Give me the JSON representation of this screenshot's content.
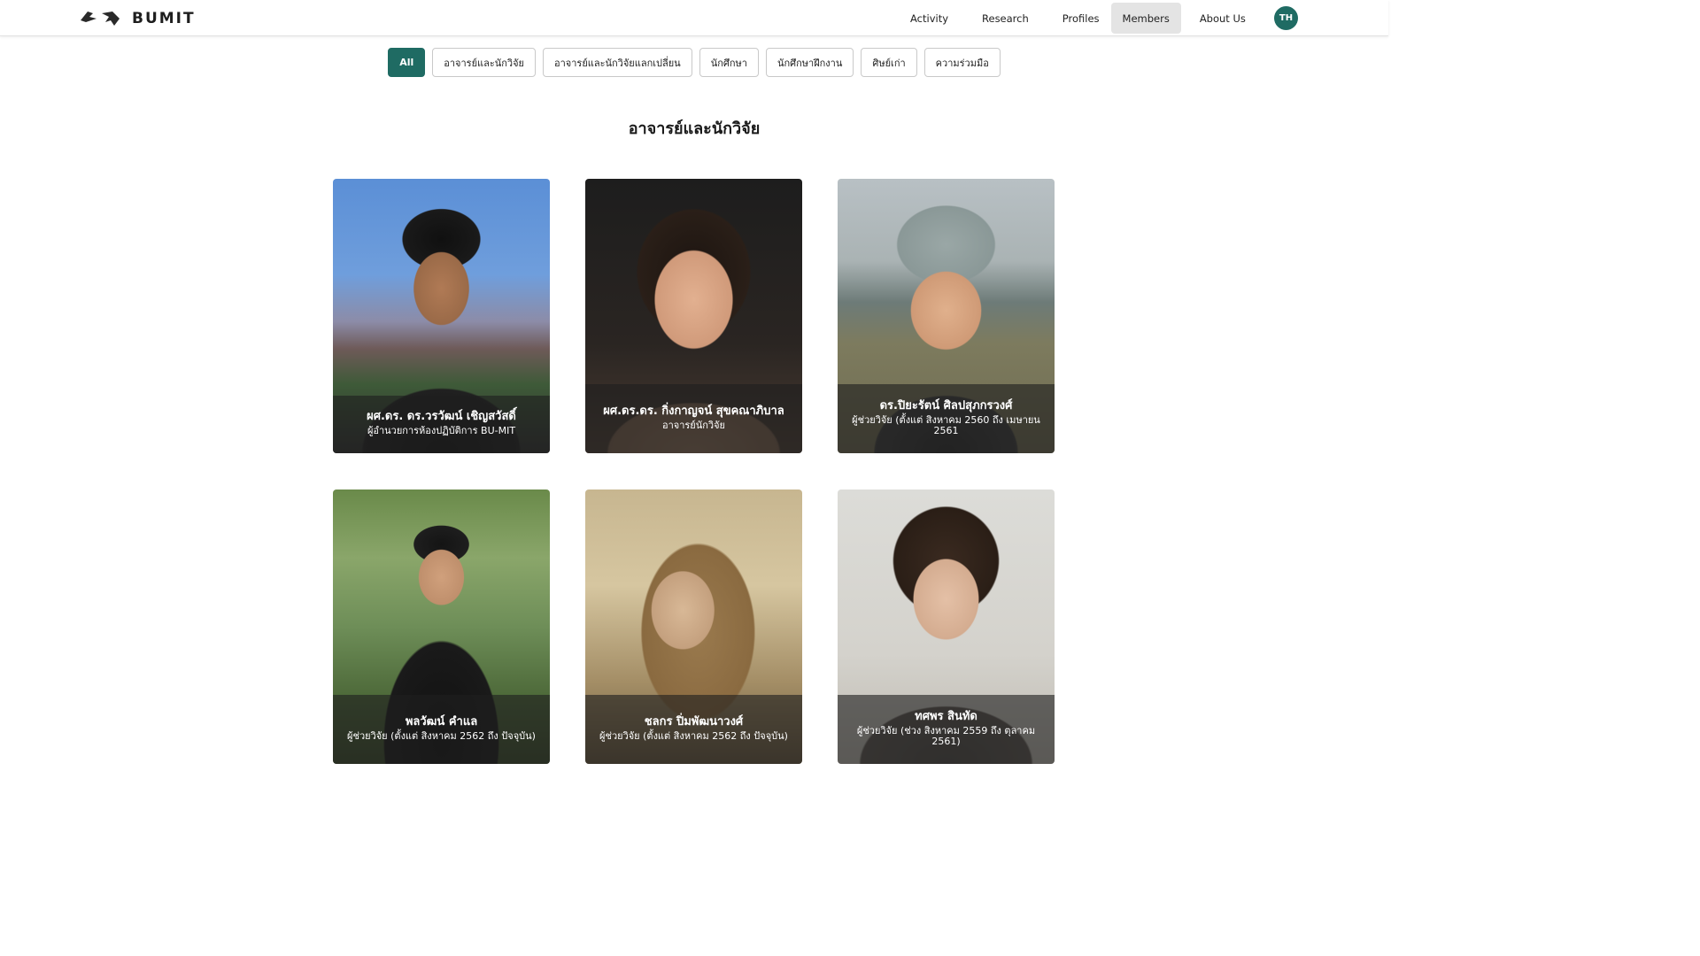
{
  "header": {
    "brand_text": "BUMIT",
    "nav": [
      {
        "label": "Activity"
      },
      {
        "label": "Research"
      },
      {
        "label": "Profiles"
      },
      {
        "label": "Members"
      },
      {
        "label": "About Us"
      }
    ],
    "active_nav": "Members",
    "lang_badge": "TH"
  },
  "filters": [
    {
      "label": "All"
    },
    {
      "label": "อาจารย์และนักวิจัย"
    },
    {
      "label": "อาจารย์และนักวิจัยแลกเปลี่ยน"
    },
    {
      "label": "นักศึกษา"
    },
    {
      "label": "นักศึกษาฝึกงาน"
    },
    {
      "label": "ศิษย์เก่า"
    },
    {
      "label": "ความร่วมมือ"
    }
  ],
  "active_filter": "All",
  "section": {
    "title": "อาจารย์และนักวิจัย"
  },
  "members": [
    {
      "name": "ผศ.ดร. ดร.วรวัฒน์ เชิญสวัสดิ์",
      "role": "ผู้อำนวยการห้องปฏิบัติการ BU-MIT"
    },
    {
      "name": "ผศ.ดร.ดร. กิ่งกาญจน์ สุขคณาภิบาล",
      "role": "อาจารย์นักวิจัย"
    },
    {
      "name": "ดร.ปิยะรัตน์ ศิลปสุภกรวงศ์",
      "role": "ผู้ช่วยวิจัย (ตั้งแต่ สิงหาคม 2560 ถึง เมษายน 2561"
    },
    {
      "name": "พลวัฒน์ คำแล",
      "role": "ผู้ช่วยวิจัย (ตั้งแต่ สิงหาคม 2562 ถึง ปัจจุบัน)"
    },
    {
      "name": "ชลกร ปิ่มพัฒนาวงศ์",
      "role": "ผู้ช่วยวิจัย (ตั้งแต่ สิงหาคม 2562 ถึง ปัจจุบัน)"
    },
    {
      "name": "ทศพร สินทัด",
      "role": "ผู้ช่วยวิจัย (ช่วง สิงหาคม 2559 ถึง ตุลาคม 2561)"
    }
  ],
  "colors": {
    "accent": "#1f6b63",
    "nav_active_bg": "#e4e4e4",
    "caption_overlay": "rgba(30,30,30,0.62)"
  }
}
